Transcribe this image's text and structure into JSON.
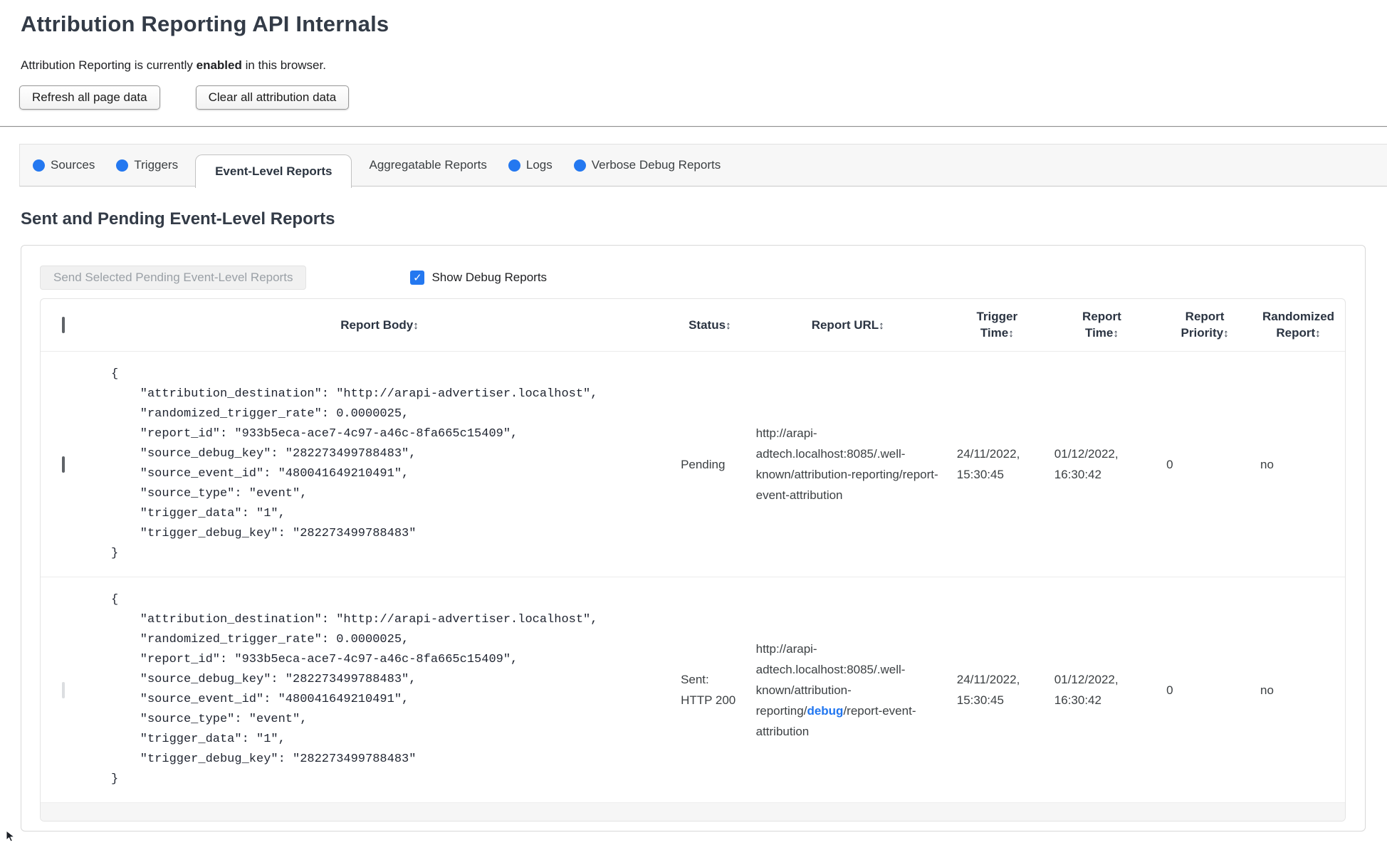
{
  "page": {
    "title": "Attribution Reporting API Internals",
    "status_prefix": "Attribution Reporting is currently ",
    "status_bold": "enabled",
    "status_suffix": " in this browser.",
    "refresh_button": "Refresh all page data",
    "clear_button": "Clear all attribution data"
  },
  "tabs": [
    {
      "label": "Sources",
      "has_dot": true,
      "active": false
    },
    {
      "label": "Triggers",
      "has_dot": true,
      "active": false
    },
    {
      "label": "Event-Level Reports",
      "has_dot": false,
      "active": true
    },
    {
      "label": "Aggregatable Reports",
      "has_dot": false,
      "active": false
    },
    {
      "label": "Logs",
      "has_dot": true,
      "active": false
    },
    {
      "label": "Verbose Debug Reports",
      "has_dot": true,
      "active": false
    }
  ],
  "section": {
    "heading": "Sent and Pending Event-Level Reports",
    "send_button": "Send Selected Pending Event-Level Reports",
    "show_debug_label": "Show Debug Reports",
    "show_debug_checked": true
  },
  "table": {
    "sort_icon": "↕",
    "headers": [
      "Report Body",
      "Status",
      "Report URL",
      "Trigger Time",
      "Report Time",
      "Report Priority",
      "Randomized Report"
    ],
    "rows": [
      {
        "checkbox_enabled": true,
        "report_body": "{\n    \"attribution_destination\": \"http://arapi-advertiser.localhost\",\n    \"randomized_trigger_rate\": 0.0000025,\n    \"report_id\": \"933b5eca-ace7-4c97-a46c-8fa665c15409\",\n    \"source_debug_key\": \"282273499788483\",\n    \"source_event_id\": \"480041649210491\",\n    \"source_type\": \"event\",\n    \"trigger_data\": \"1\",\n    \"trigger_debug_key\": \"282273499788483\"\n}",
        "status": "Pending",
        "report_url": "http://arapi-adtech.localhost:8085/.well-known/attribution-reporting/report-event-attribution",
        "trigger_time": "24/11/2022, 15:30:45",
        "report_time": "01/12/2022, 16:30:42",
        "report_priority": "0",
        "randomized_report": "no"
      },
      {
        "checkbox_enabled": false,
        "report_body": "{\n    \"attribution_destination\": \"http://arapi-advertiser.localhost\",\n    \"randomized_trigger_rate\": 0.0000025,\n    \"report_id\": \"933b5eca-ace7-4c97-a46c-8fa665c15409\",\n    \"source_debug_key\": \"282273499788483\",\n    \"source_event_id\": \"480041649210491\",\n    \"source_type\": \"event\",\n    \"trigger_data\": \"1\",\n    \"trigger_debug_key\": \"282273499788483\"\n}",
        "status": "Sent: HTTP 200",
        "report_url_before": "http://arapi-adtech.localhost:8085/.well-known/attribution-reporting/",
        "report_url_debug": "debug",
        "report_url_after": "/report-event-attribution",
        "trigger_time": "24/11/2022, 15:30:45",
        "report_time": "01/12/2022, 16:30:42",
        "report_priority": "0",
        "randomized_report": "no"
      }
    ]
  },
  "colors": {
    "accent_blue": "#2478f0",
    "heading_text": "#333b47",
    "tabstrip_bg": "#f7f7f7"
  }
}
